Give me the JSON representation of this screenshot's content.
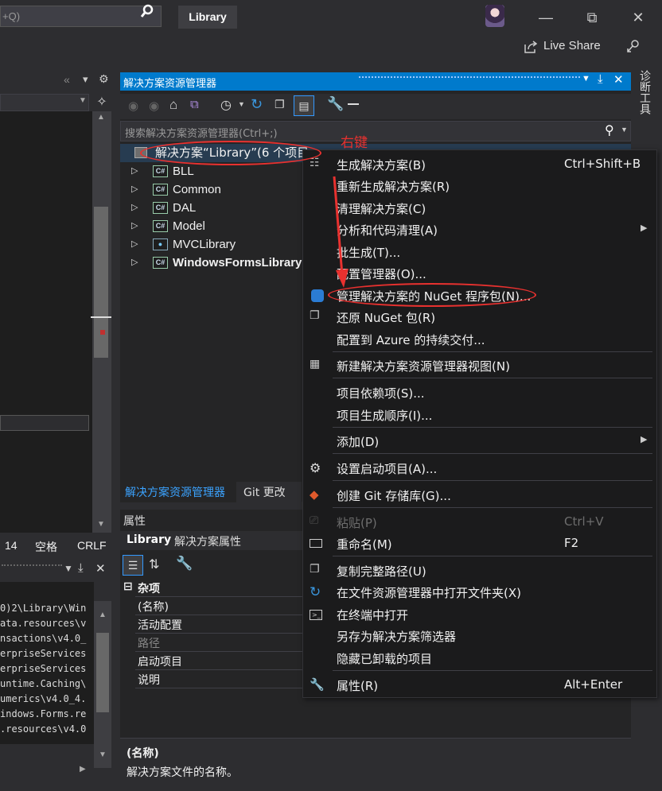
{
  "titlebar": {
    "search_text": "+Q)",
    "project_badge": "Library",
    "live_share": "Live Share"
  },
  "left": {
    "status_items": [
      "14",
      "空格",
      "CRLF"
    ],
    "output_lines": [
      "0)2\\Library\\Win",
      "ata.resources\\v",
      "nsactions\\v4.0_",
      "erpriseServices",
      "erpriseServices",
      "untime.Caching\\",
      "umerics\\v4.0_4.",
      "indows.Forms.re",
      ".resources\\v4.0"
    ]
  },
  "solution_explorer": {
    "title": "解决方案资源管理器",
    "search_placeholder": "搜索解决方案资源管理器(Ctrl+;)",
    "solution_label": "解决方案“Library”(6 个项目",
    "projects": [
      "BLL",
      "Common",
      "DAL",
      "Model",
      "MVCLibrary",
      "WindowsFormsLibrary"
    ],
    "tabs": [
      "解决方案资源管理器",
      "Git 更改"
    ]
  },
  "properties": {
    "title": "属性",
    "object_name": "Library",
    "object_type": "解决方案属性",
    "category": "杂项",
    "rows": [
      "(名称)",
      "活动配置",
      "路径",
      "启动项目",
      "说明"
    ],
    "desc_title": "(名称)",
    "desc_text": "解决方案文件的名称。"
  },
  "side_tab": "诊断工具",
  "annotation": {
    "text": "右键"
  },
  "context_menu": {
    "items": [
      {
        "label": "生成解决方案(B)",
        "shortcut": "Ctrl+Shift+B"
      },
      {
        "label": "重新生成解决方案(R)",
        "shortcut": ""
      },
      {
        "label": "清理解决方案(C)",
        "shortcut": ""
      },
      {
        "label": "分析和代码清理(A)",
        "shortcut": ""
      },
      {
        "label": "批生成(T)...",
        "shortcut": ""
      },
      {
        "label": "配置管理器(O)...",
        "shortcut": ""
      },
      {
        "label": "管理解决方案的 NuGet 程序包(N)...",
        "shortcut": ""
      },
      {
        "label": "还原 NuGet 包(R)",
        "shortcut": ""
      },
      {
        "label": "配置到 Azure 的持续交付...",
        "shortcut": ""
      },
      {
        "label": "新建解决方案资源管理器视图(N)",
        "shortcut": ""
      },
      {
        "label": "项目依赖项(S)...",
        "shortcut": ""
      },
      {
        "label": "项目生成顺序(I)...",
        "shortcut": ""
      },
      {
        "label": "添加(D)",
        "shortcut": ""
      },
      {
        "label": "设置启动项目(A)...",
        "shortcut": ""
      },
      {
        "label": "创建 Git 存储库(G)...",
        "shortcut": ""
      },
      {
        "label": "粘贴(P)",
        "shortcut": "Ctrl+V"
      },
      {
        "label": "重命名(M)",
        "shortcut": "F2"
      },
      {
        "label": "复制完整路径(U)",
        "shortcut": ""
      },
      {
        "label": "在文件资源管理器中打开文件夹(X)",
        "shortcut": ""
      },
      {
        "label": "在终端中打开",
        "shortcut": ""
      },
      {
        "label": "另存为解决方案筛选器",
        "shortcut": ""
      },
      {
        "label": "隐藏已卸载的项目",
        "shortcut": ""
      },
      {
        "label": "属性(R)",
        "shortcut": "Alt+Enter"
      }
    ]
  }
}
